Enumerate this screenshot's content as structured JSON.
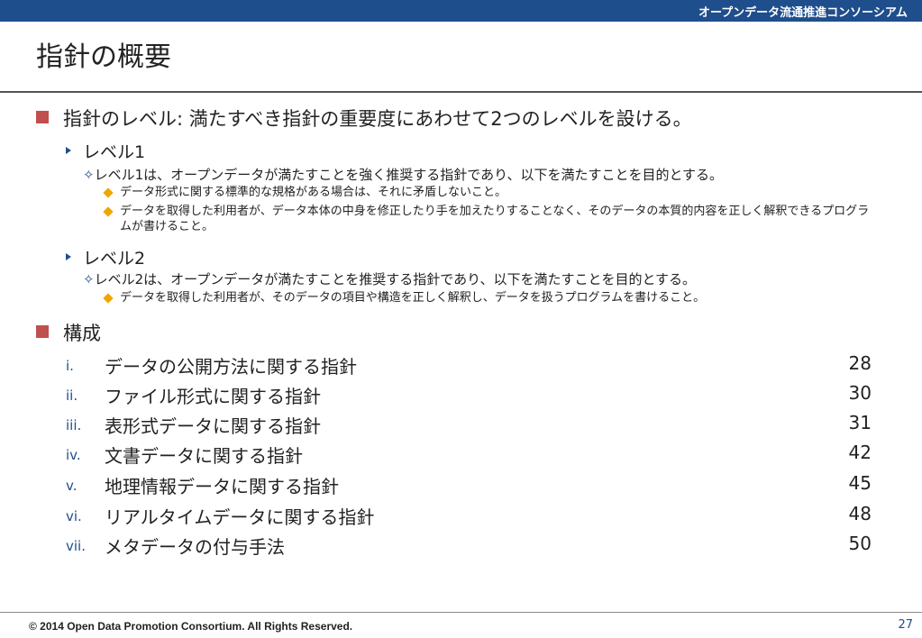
{
  "header": {
    "org": "オープンデータ流通推進コンソーシアム"
  },
  "title": "指針の概要",
  "section1": {
    "text": "指針のレベル: 満たすべき指針の重要度にあわせて2つのレベルを設ける。",
    "level1": {
      "label": "レベル1",
      "desc": "レベル1は、オープンデータが満たすことを強く推奨する指針であり、以下を満たすことを目的とする。",
      "items": [
        "データ形式に関する標準的な規格がある場合は、それに矛盾しないこと。",
        "データを取得した利用者が、データ本体の中身を修正したり手を加えたりすることなく、そのデータの本質的内容を正しく解釈できるプログラムが書けること。"
      ]
    },
    "level2": {
      "label": "レベル2",
      "desc": "レベル2は、オープンデータが満たすことを推奨する指針であり、以下を満たすことを目的とする。",
      "items": [
        "データを取得した利用者が、そのデータの項目や構造を正しく解釈し、データを扱うプログラムを書けること。"
      ]
    }
  },
  "section2": {
    "text": "構成",
    "toc": [
      {
        "num": "i.",
        "label": "データの公開方法に関する指針",
        "page": "28"
      },
      {
        "num": "ii.",
        "label": "ファイル形式に関する指針",
        "page": "30"
      },
      {
        "num": "iii.",
        "label": "表形式データに関する指針",
        "page": "31"
      },
      {
        "num": "iv.",
        "label": "文書データに関する指針",
        "page": "42"
      },
      {
        "num": "v.",
        "label": "地理情報データに関する指針",
        "page": "45"
      },
      {
        "num": "vi.",
        "label": "リアルタイムデータに関する指針",
        "page": "48"
      },
      {
        "num": "vii.",
        "label": "メタデータの付与手法",
        "page": "50"
      }
    ]
  },
  "footer": {
    "copyright": "© 2014 Open Data Promotion Consortium. All Rights Reserved.",
    "page": "27"
  },
  "colors": {
    "header_bar": "#1f4e8c",
    "bullet_square": "#c0504d",
    "diamond": "#f0a500",
    "accent_text": "#1f4e8c"
  }
}
